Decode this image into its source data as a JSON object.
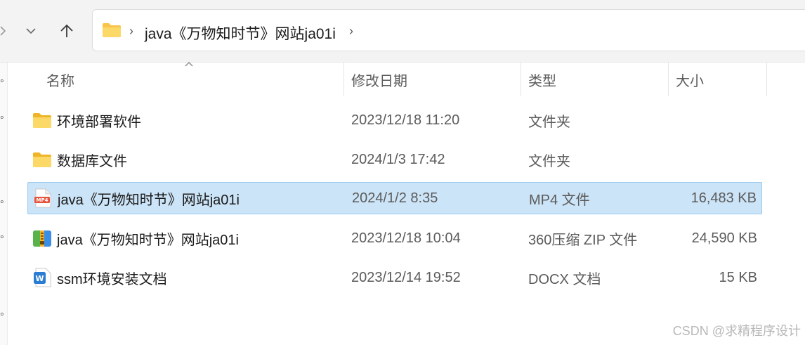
{
  "navigation": {
    "path_separator": "›",
    "path": [
      "java《万物知时节》网站ja01i"
    ]
  },
  "columns": {
    "name": "名称",
    "date": "修改日期",
    "type": "类型",
    "size": "大小"
  },
  "files": [
    {
      "name": "环境部署软件",
      "date": "2023/12/18 11:20",
      "type": "文件夹",
      "size": "",
      "icon": "folder-icon",
      "selected": false
    },
    {
      "name": "数据库文件",
      "date": "2024/1/3 17:42",
      "type": "文件夹",
      "size": "",
      "icon": "folder-icon",
      "selected": false
    },
    {
      "name": "java《万物知时节》网站ja01i",
      "date": "2024/1/2 8:35",
      "type": "MP4 文件",
      "size": "16,483 KB",
      "icon": "mp4-file-icon",
      "selected": true
    },
    {
      "name": "java《万物知时节》网站ja01i",
      "date": "2023/12/18 10:04",
      "type": "360压缩 ZIP 文件",
      "size": "24,590 KB",
      "icon": "zip-archive-icon",
      "selected": false
    },
    {
      "name": "ssm环境安装文档",
      "date": "2023/12/14 19:52",
      "type": "DOCX 文档",
      "size": "15 KB",
      "icon": "docx-file-icon",
      "selected": false
    }
  ],
  "file_icon_labels": {
    "mp4": "MP4",
    "docx": "W"
  },
  "colors": {
    "selection": "#cce4f7",
    "selection_border": "#99c9ef",
    "folder": "#f8c54a",
    "mp4": "#e8533b",
    "docx": "#2b7cd3"
  },
  "watermark": "CSDN @求精程序设计"
}
